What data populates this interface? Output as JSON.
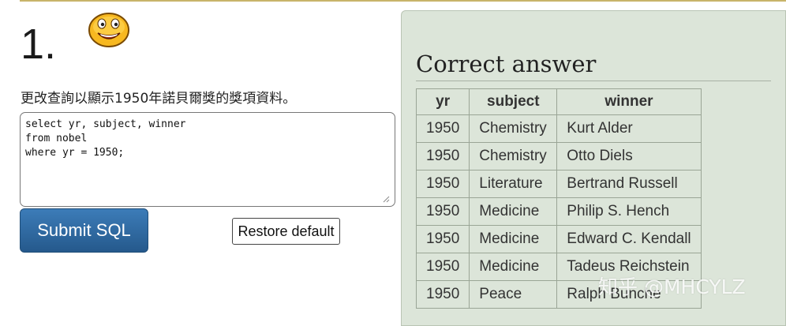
{
  "question": {
    "number": "1.",
    "prompt": "更改查詢以顯示1950年諾貝爾獎的獎項資料。",
    "emoticon": "smiley-face-icon"
  },
  "editor": {
    "sql": "select yr, subject, winner\nfrom nobel\nwhere yr = 1950;"
  },
  "buttons": {
    "submit_label": "Submit SQL",
    "restore_label": "Restore default"
  },
  "answer": {
    "title": "Correct answer",
    "columns": [
      "yr",
      "subject",
      "winner"
    ],
    "rows": [
      [
        "1950",
        "Chemistry",
        "Kurt Alder"
      ],
      [
        "1950",
        "Chemistry",
        "Otto Diels"
      ],
      [
        "1950",
        "Literature",
        "Bertrand Russell"
      ],
      [
        "1950",
        "Medicine",
        "Philip S. Hench"
      ],
      [
        "1950",
        "Medicine",
        "Edward C. Kendall"
      ],
      [
        "1950",
        "Medicine",
        "Tadeus Reichstein"
      ],
      [
        "1950",
        "Peace",
        "Ralph Bunche"
      ]
    ]
  },
  "watermark": "知乎 @MHCYLZ",
  "colors": {
    "panel_bg": "#dce5d9",
    "submit_bg": "#2f6aa3",
    "top_rule": "#c8b46a"
  }
}
